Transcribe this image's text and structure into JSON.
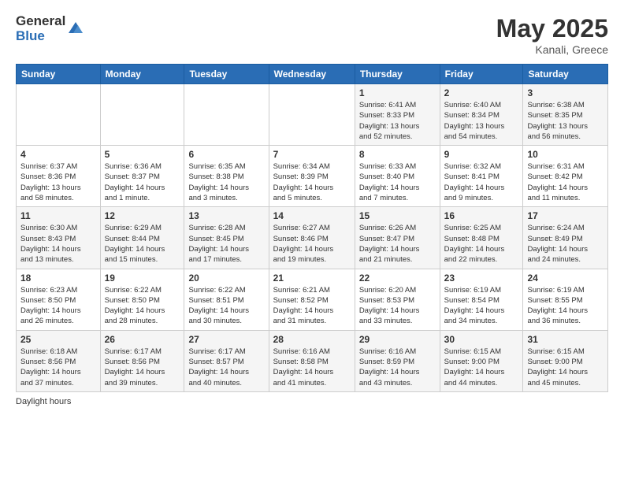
{
  "logo": {
    "general": "General",
    "blue": "Blue"
  },
  "header": {
    "month_year": "May 2025",
    "location": "Kanali, Greece"
  },
  "weekdays": [
    "Sunday",
    "Monday",
    "Tuesday",
    "Wednesday",
    "Thursday",
    "Friday",
    "Saturday"
  ],
  "weeks": [
    [
      {
        "day": "",
        "info": ""
      },
      {
        "day": "",
        "info": ""
      },
      {
        "day": "",
        "info": ""
      },
      {
        "day": "",
        "info": ""
      },
      {
        "day": "1",
        "info": "Sunrise: 6:41 AM\nSunset: 8:33 PM\nDaylight: 13 hours\nand 52 minutes."
      },
      {
        "day": "2",
        "info": "Sunrise: 6:40 AM\nSunset: 8:34 PM\nDaylight: 13 hours\nand 54 minutes."
      },
      {
        "day": "3",
        "info": "Sunrise: 6:38 AM\nSunset: 8:35 PM\nDaylight: 13 hours\nand 56 minutes."
      }
    ],
    [
      {
        "day": "4",
        "info": "Sunrise: 6:37 AM\nSunset: 8:36 PM\nDaylight: 13 hours\nand 58 minutes."
      },
      {
        "day": "5",
        "info": "Sunrise: 6:36 AM\nSunset: 8:37 PM\nDaylight: 14 hours\nand 1 minute."
      },
      {
        "day": "6",
        "info": "Sunrise: 6:35 AM\nSunset: 8:38 PM\nDaylight: 14 hours\nand 3 minutes."
      },
      {
        "day": "7",
        "info": "Sunrise: 6:34 AM\nSunset: 8:39 PM\nDaylight: 14 hours\nand 5 minutes."
      },
      {
        "day": "8",
        "info": "Sunrise: 6:33 AM\nSunset: 8:40 PM\nDaylight: 14 hours\nand 7 minutes."
      },
      {
        "day": "9",
        "info": "Sunrise: 6:32 AM\nSunset: 8:41 PM\nDaylight: 14 hours\nand 9 minutes."
      },
      {
        "day": "10",
        "info": "Sunrise: 6:31 AM\nSunset: 8:42 PM\nDaylight: 14 hours\nand 11 minutes."
      }
    ],
    [
      {
        "day": "11",
        "info": "Sunrise: 6:30 AM\nSunset: 8:43 PM\nDaylight: 14 hours\nand 13 minutes."
      },
      {
        "day": "12",
        "info": "Sunrise: 6:29 AM\nSunset: 8:44 PM\nDaylight: 14 hours\nand 15 minutes."
      },
      {
        "day": "13",
        "info": "Sunrise: 6:28 AM\nSunset: 8:45 PM\nDaylight: 14 hours\nand 17 minutes."
      },
      {
        "day": "14",
        "info": "Sunrise: 6:27 AM\nSunset: 8:46 PM\nDaylight: 14 hours\nand 19 minutes."
      },
      {
        "day": "15",
        "info": "Sunrise: 6:26 AM\nSunset: 8:47 PM\nDaylight: 14 hours\nand 21 minutes."
      },
      {
        "day": "16",
        "info": "Sunrise: 6:25 AM\nSunset: 8:48 PM\nDaylight: 14 hours\nand 22 minutes."
      },
      {
        "day": "17",
        "info": "Sunrise: 6:24 AM\nSunset: 8:49 PM\nDaylight: 14 hours\nand 24 minutes."
      }
    ],
    [
      {
        "day": "18",
        "info": "Sunrise: 6:23 AM\nSunset: 8:50 PM\nDaylight: 14 hours\nand 26 minutes."
      },
      {
        "day": "19",
        "info": "Sunrise: 6:22 AM\nSunset: 8:50 PM\nDaylight: 14 hours\nand 28 minutes."
      },
      {
        "day": "20",
        "info": "Sunrise: 6:22 AM\nSunset: 8:51 PM\nDaylight: 14 hours\nand 30 minutes."
      },
      {
        "day": "21",
        "info": "Sunrise: 6:21 AM\nSunset: 8:52 PM\nDaylight: 14 hours\nand 31 minutes."
      },
      {
        "day": "22",
        "info": "Sunrise: 6:20 AM\nSunset: 8:53 PM\nDaylight: 14 hours\nand 33 minutes."
      },
      {
        "day": "23",
        "info": "Sunrise: 6:19 AM\nSunset: 8:54 PM\nDaylight: 14 hours\nand 34 minutes."
      },
      {
        "day": "24",
        "info": "Sunrise: 6:19 AM\nSunset: 8:55 PM\nDaylight: 14 hours\nand 36 minutes."
      }
    ],
    [
      {
        "day": "25",
        "info": "Sunrise: 6:18 AM\nSunset: 8:56 PM\nDaylight: 14 hours\nand 37 minutes."
      },
      {
        "day": "26",
        "info": "Sunrise: 6:17 AM\nSunset: 8:56 PM\nDaylight: 14 hours\nand 39 minutes."
      },
      {
        "day": "27",
        "info": "Sunrise: 6:17 AM\nSunset: 8:57 PM\nDaylight: 14 hours\nand 40 minutes."
      },
      {
        "day": "28",
        "info": "Sunrise: 6:16 AM\nSunset: 8:58 PM\nDaylight: 14 hours\nand 41 minutes."
      },
      {
        "day": "29",
        "info": "Sunrise: 6:16 AM\nSunset: 8:59 PM\nDaylight: 14 hours\nand 43 minutes."
      },
      {
        "day": "30",
        "info": "Sunrise: 6:15 AM\nSunset: 9:00 PM\nDaylight: 14 hours\nand 44 minutes."
      },
      {
        "day": "31",
        "info": "Sunrise: 6:15 AM\nSunset: 9:00 PM\nDaylight: 14 hours\nand 45 minutes."
      }
    ]
  ],
  "footer": {
    "daylight_label": "Daylight hours"
  }
}
